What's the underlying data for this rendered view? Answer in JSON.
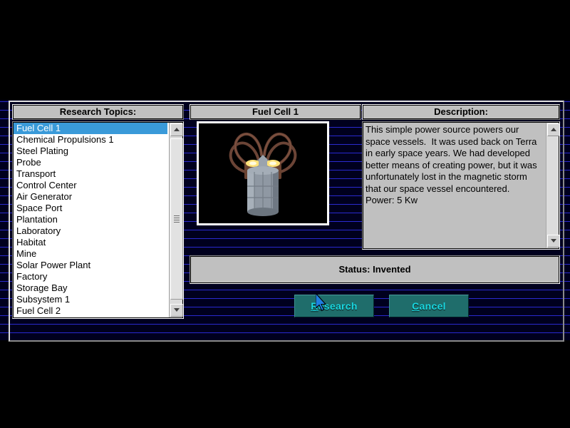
{
  "window": {
    "background_color": "#000000",
    "scanline_color": "#2a2ad0"
  },
  "panels": {
    "topics_header": "Research Topics:",
    "image_header": "Fuel Cell 1",
    "description_header": "Description:"
  },
  "topics": {
    "selected_index": 0,
    "items": [
      "Fuel Cell 1",
      "Chemical Propulsions 1",
      "Steel Plating",
      "Probe",
      "Transport",
      "Control Center",
      "Air Generator",
      "Space Port",
      "Plantation",
      "Laboratory",
      "Habitat",
      "Mine",
      "Solar Power Plant",
      "Factory",
      "Storage Bay",
      "Subsystem 1",
      "Fuel Cell 2"
    ],
    "highlight_color": "#3a9ad9"
  },
  "description": {
    "text": "This simple power source powers our space vessels.  It was used back on Terra in early space years. We had developed better means of creating power, but it was unfortunately lost in the magnetic storm that our space vessel encountered.  Power: 5 Kw"
  },
  "status": {
    "label": "Status: Invented"
  },
  "buttons": {
    "research": {
      "label": "Research",
      "accel": "R",
      "text_color": "#19d7e0"
    },
    "cancel": {
      "label": "Cancel",
      "accel": "C",
      "text_color": "#19d7e0"
    }
  },
  "item_image": {
    "name": "fuel-cell-render",
    "body_color": "#8f98a3",
    "coil_color": "#6b4436",
    "glow_color": "#ffe27a"
  }
}
